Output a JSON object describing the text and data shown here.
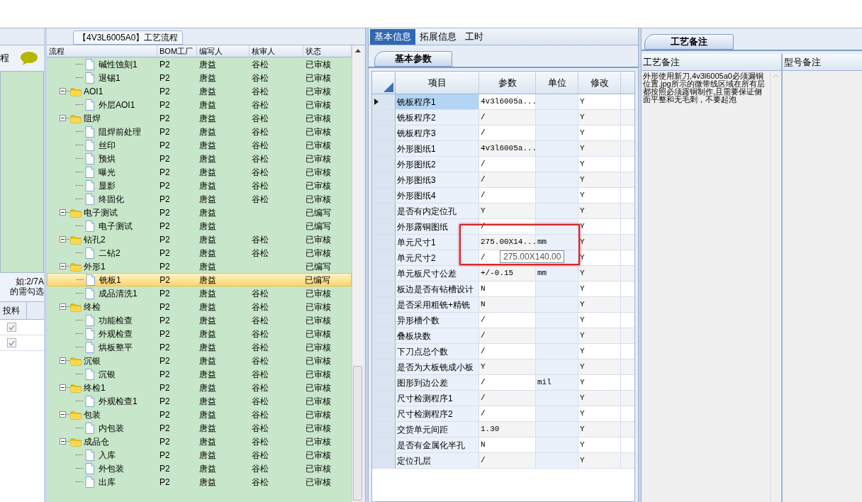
{
  "left_panel": {
    "title_fragment": "程",
    "note_lines": [
      "如:2/7A",
      "的需勾选"
    ],
    "column": "投料",
    "rows": [
      {
        "checked": true
      },
      {
        "checked": true
      }
    ]
  },
  "flow_panel": {
    "title": "【4V3L6005A0】工艺流程",
    "columns": [
      "流程",
      "BOM工厂",
      "编写人",
      "核审人",
      "状态"
    ],
    "tree": [
      {
        "children": [
          {
            "label": "碱性蚀刻1",
            "bom": "P2",
            "writer": "唐益",
            "reviewer": "谷松",
            "status": "已审核",
            "selected": false
          },
          {
            "label": "退锡1",
            "bom": "P2",
            "writer": "唐益",
            "reviewer": "谷松",
            "status": "已审核",
            "selected": false
          }
        ]
      },
      {
        "label": "AOI1",
        "bom": "P2",
        "writer": "唐益",
        "reviewer": "谷松",
        "status": "已审核",
        "selected": false,
        "expanded": true,
        "children": [
          {
            "label": "外层AOI1",
            "bom": "P2",
            "writer": "唐益",
            "reviewer": "谷松",
            "status": "已审核",
            "selected": false
          }
        ]
      },
      {
        "label": "阻焊",
        "bom": "P2",
        "writer": "唐益",
        "reviewer": "谷松",
        "status": "已审核",
        "selected": false,
        "expanded": true,
        "children": [
          {
            "label": "阻焊前处理",
            "bom": "P2",
            "writer": "唐益",
            "reviewer": "谷松",
            "status": "已审核",
            "selected": false
          },
          {
            "label": "丝印",
            "bom": "P2",
            "writer": "唐益",
            "reviewer": "谷松",
            "status": "已审核",
            "selected": false
          },
          {
            "label": "预烘",
            "bom": "P2",
            "writer": "唐益",
            "reviewer": "谷松",
            "status": "已审核",
            "selected": false
          },
          {
            "label": "曝光",
            "bom": "P2",
            "writer": "唐益",
            "reviewer": "谷松",
            "status": "已审核",
            "selected": false
          },
          {
            "label": "显影",
            "bom": "P2",
            "writer": "唐益",
            "reviewer": "谷松",
            "status": "已审核",
            "selected": false
          },
          {
            "label": "终固化",
            "bom": "P2",
            "writer": "唐益",
            "reviewer": "谷松",
            "status": "已审核",
            "selected": false
          }
        ]
      },
      {
        "label": "电子测试",
        "bom": "P2",
        "writer": "唐益",
        "status": "已编写",
        "selected": false,
        "expanded": true,
        "children": [
          {
            "label": "电子测试",
            "bom": "P2",
            "writer": "唐益",
            "status": "已编写",
            "selected": false
          }
        ]
      },
      {
        "label": "钻孔2",
        "bom": "P2",
        "writer": "唐益",
        "reviewer": "谷松",
        "status": "已审核",
        "selected": false,
        "expanded": true,
        "children": [
          {
            "label": "二钻2",
            "bom": "P2",
            "writer": "唐益",
            "reviewer": "谷松",
            "status": "已审核",
            "selected": false
          }
        ]
      },
      {
        "label": "外形1",
        "bom": "P2",
        "writer": "唐益",
        "status": "已编写",
        "selected": false,
        "expanded": true,
        "children": [
          {
            "label": "铣板1",
            "bom": "P2",
            "writer": "唐益",
            "status": "已编写",
            "selected": true
          },
          {
            "label": "成品清洗1",
            "bom": "P2",
            "writer": "唐益",
            "reviewer": "谷松",
            "status": "已审核",
            "selected": false
          }
        ]
      },
      {
        "label": "终检",
        "bom": "P2",
        "writer": "唐益",
        "reviewer": "谷松",
        "status": "已审核",
        "selected": false,
        "expanded": true,
        "children": [
          {
            "label": "功能检查",
            "bom": "P2",
            "writer": "唐益",
            "reviewer": "谷松",
            "status": "已审核",
            "selected": false
          },
          {
            "label": "外观检查",
            "bom": "P2",
            "writer": "唐益",
            "reviewer": "谷松",
            "status": "已审核",
            "selected": false
          },
          {
            "label": "烘板整平",
            "bom": "P2",
            "writer": "唐益",
            "reviewer": "谷松",
            "status": "已审核",
            "selected": false
          }
        ]
      },
      {
        "label": "沉银",
        "bom": "P2",
        "writer": "唐益",
        "reviewer": "谷松",
        "status": "已审核",
        "selected": false,
        "expanded": true,
        "children": [
          {
            "label": "沉银",
            "bom": "P2",
            "writer": "唐益",
            "reviewer": "谷松",
            "status": "已审核",
            "selected": false
          }
        ]
      },
      {
        "label": "终检1",
        "bom": "P2",
        "writer": "唐益",
        "reviewer": "谷松",
        "status": "已审核",
        "selected": false,
        "expanded": true,
        "children": [
          {
            "label": "外观检查1",
            "bom": "P2",
            "writer": "唐益",
            "reviewer": "谷松",
            "status": "已审核",
            "selected": false
          }
        ]
      },
      {
        "label": "包装",
        "bom": "P2",
        "writer": "唐益",
        "reviewer": "谷松",
        "status": "已审核",
        "selected": false,
        "expanded": true,
        "children": [
          {
            "label": "内包装",
            "bom": "P2",
            "writer": "唐益",
            "reviewer": "谷松",
            "status": "已审核",
            "selected": false
          }
        ]
      },
      {
        "label": "成品仓",
        "bom": "P2",
        "writer": "唐益",
        "reviewer": "谷松",
        "status": "已审核",
        "selected": false,
        "expanded": true,
        "children": [
          {
            "label": "入库",
            "bom": "P2",
            "writer": "唐益",
            "reviewer": "谷松",
            "status": "已审核",
            "selected": false
          },
          {
            "label": "外包装",
            "bom": "P2",
            "writer": "唐益",
            "reviewer": "谷松",
            "status": "已审核",
            "selected": false
          },
          {
            "label": "出库",
            "bom": "P2",
            "writer": "唐益",
            "reviewer": "谷松",
            "status": "已审核",
            "selected": false
          }
        ]
      }
    ]
  },
  "info_panel": {
    "tabs": [
      {
        "label": "基本信息",
        "selected": true
      },
      {
        "label": "拓展信息",
        "selected": false
      },
      {
        "label": "工时",
        "selected": false
      }
    ],
    "subtab": "基本参数",
    "columns": [
      "项目",
      "参数",
      "单位",
      "修改"
    ],
    "rows": [
      {
        "item": "铣板程序1",
        "param": "4v3l6005a...",
        "modify": "Y",
        "selected": true
      },
      {
        "item": "铣板程序2",
        "param": "/",
        "modify": "Y",
        "selected": false
      },
      {
        "item": "铣板程序3",
        "param": "/",
        "modify": "Y",
        "selected": false
      },
      {
        "item": "外形图纸1",
        "param": "4v3l6005a...",
        "modify": "Y",
        "selected": false
      },
      {
        "item": "外形图纸2",
        "param": "/",
        "modify": "Y",
        "selected": false
      },
      {
        "item": "外形图纸3",
        "param": "/",
        "modify": "Y",
        "selected": false
      },
      {
        "item": "外形图纸4",
        "param": "/",
        "modify": "Y",
        "selected": false
      },
      {
        "item": "是否有内定位孔",
        "param": "Y",
        "modify": "Y",
        "selected": false
      },
      {
        "item": "外形露铜图纸",
        "param": "/",
        "modify": "Y",
        "selected": false
      },
      {
        "item": "单元尺寸1",
        "param": "275.00X14...",
        "unit": "mm",
        "modify": "Y",
        "selected": false
      },
      {
        "item": "单元尺寸2",
        "param": "/",
        "modify": "Y",
        "selected": false
      },
      {
        "item": "单元板尺寸公差",
        "param": "+/-0.15",
        "unit": "mm",
        "modify": "Y",
        "selected": false
      },
      {
        "item": "板边是否有钻槽设计",
        "param": "N",
        "modify": "Y",
        "selected": false
      },
      {
        "item": "是否采用粗铣+精铣",
        "param": "N",
        "modify": "Y",
        "selected": false
      },
      {
        "item": "异形槽个数",
        "param": "/",
        "modify": "Y",
        "selected": false
      },
      {
        "item": "叠板块数",
        "param": "/",
        "modify": "Y",
        "selected": false
      },
      {
        "item": "下刀点总个数",
        "param": "/",
        "modify": "Y",
        "selected": false
      },
      {
        "item": "是否为大板铣成小板",
        "param": "Y",
        "modify": "Y",
        "selected": false
      },
      {
        "item": "图形到边公差",
        "param": "/",
        "unit": "mil",
        "modify": "Y",
        "selected": false
      },
      {
        "item": "尺寸检测程序1",
        "param": "/",
        "modify": "Y",
        "selected": false
      },
      {
        "item": "尺寸检测程序2",
        "param": "/",
        "modify": "Y",
        "selected": false
      },
      {
        "item": "交货单元间距",
        "param": "1.30",
        "modify": "Y",
        "selected": false
      },
      {
        "item": "是否有金属化半孔",
        "param": "N",
        "modify": "Y",
        "selected": false
      },
      {
        "item": "定位孔层",
        "param": "/",
        "modify": "Y",
        "selected": false
      }
    ],
    "tooltip": "275.00X140.00"
  },
  "notes_panel": {
    "subtab": "工艺备注",
    "columns": [
      "工艺备注",
      "型号备注"
    ],
    "process_note": "外形使用新刀,4v3l6005a0必须漏铜位置.jpg所示的微带线区域在所有层都按照必须露铜制作,且需要保证侧面平整和无毛刺，不要起泡"
  }
}
